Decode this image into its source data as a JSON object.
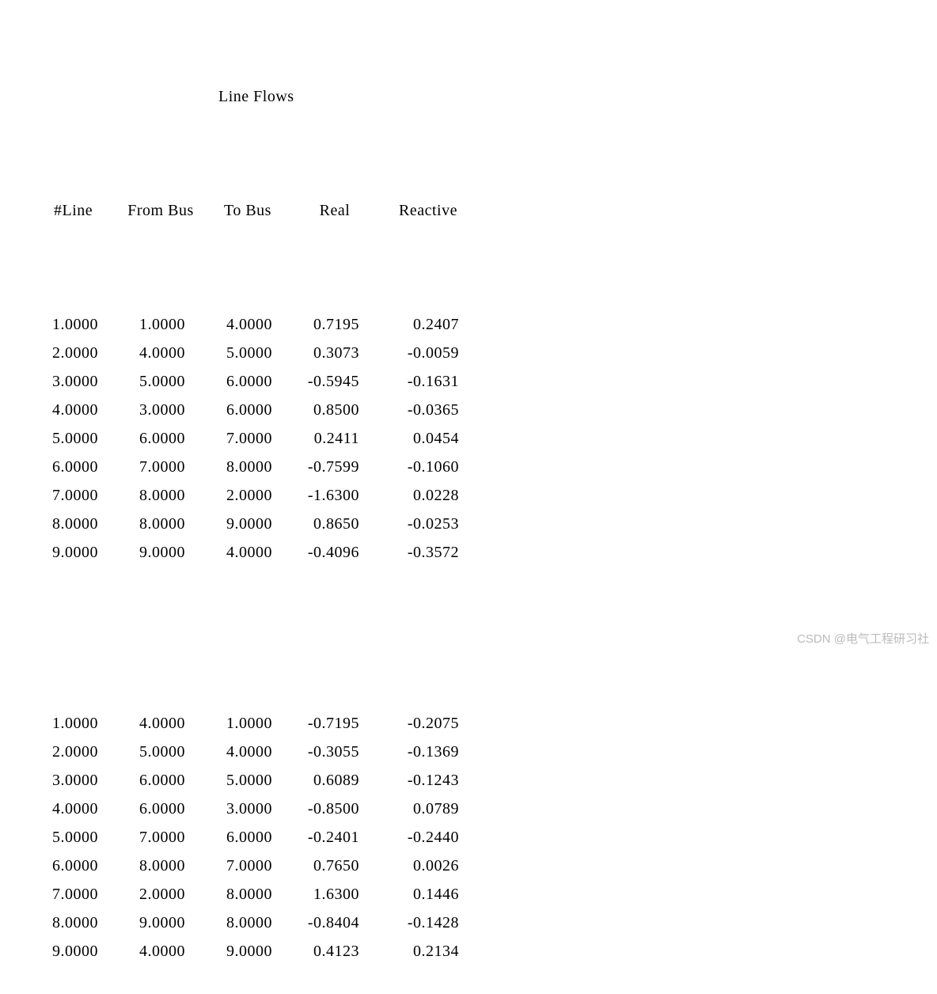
{
  "title": "Line Flows",
  "headers": {
    "line": "#Line",
    "from": "From Bus",
    "to": "To Bus",
    "real": "Real",
    "reactive": "Reactive"
  },
  "rows_a": [
    {
      "line": "1.0000",
      "from": "1.0000",
      "to": "4.0000",
      "real": "0.7195",
      "reactive": "0.2407"
    },
    {
      "line": "2.0000",
      "from": "4.0000",
      "to": "5.0000",
      "real": "0.3073",
      "reactive": "-0.0059"
    },
    {
      "line": "3.0000",
      "from": "5.0000",
      "to": "6.0000",
      "real": "-0.5945",
      "reactive": "-0.1631"
    },
    {
      "line": "4.0000",
      "from": "3.0000",
      "to": "6.0000",
      "real": "0.8500",
      "reactive": "-0.0365"
    },
    {
      "line": "5.0000",
      "from": "6.0000",
      "to": "7.0000",
      "real": "0.2411",
      "reactive": "0.0454"
    },
    {
      "line": "6.0000",
      "from": "7.0000",
      "to": "8.0000",
      "real": "-0.7599",
      "reactive": "-0.1060"
    },
    {
      "line": "7.0000",
      "from": "8.0000",
      "to": "2.0000",
      "real": "-1.6300",
      "reactive": "0.0228"
    },
    {
      "line": "8.0000",
      "from": "8.0000",
      "to": "9.0000",
      "real": "0.8650",
      "reactive": "-0.0253"
    },
    {
      "line": "9.0000",
      "from": "9.0000",
      "to": "4.0000",
      "real": "-0.4096",
      "reactive": "-0.3572"
    }
  ],
  "rows_b": [
    {
      "line": "1.0000",
      "from": "4.0000",
      "to": "1.0000",
      "real": "-0.7195",
      "reactive": "-0.2075"
    },
    {
      "line": "2.0000",
      "from": "5.0000",
      "to": "4.0000",
      "real": "-0.3055",
      "reactive": "-0.1369"
    },
    {
      "line": "3.0000",
      "from": "6.0000",
      "to": "5.0000",
      "real": "0.6089",
      "reactive": "-0.1243"
    },
    {
      "line": "4.0000",
      "from": "6.0000",
      "to": "3.0000",
      "real": "-0.8500",
      "reactive": "0.0789"
    },
    {
      "line": "5.0000",
      "from": "7.0000",
      "to": "6.0000",
      "real": "-0.2401",
      "reactive": "-0.2440"
    },
    {
      "line": "6.0000",
      "from": "8.0000",
      "to": "7.0000",
      "real": "0.7650",
      "reactive": "0.0026"
    },
    {
      "line": "7.0000",
      "from": "2.0000",
      "to": "8.0000",
      "real": "1.6300",
      "reactive": "0.1446"
    },
    {
      "line": "8.0000",
      "from": "9.0000",
      "to": "8.0000",
      "real": "-0.8404",
      "reactive": "-0.1428"
    },
    {
      "line": "9.0000",
      "from": "4.0000",
      "to": "9.0000",
      "real": "0.4123",
      "reactive": "0.2134"
    }
  ],
  "watermark": "CSDN @电气工程研习社",
  "chart_data": {
    "type": "table",
    "title": "Line Flows",
    "columns": [
      "#Line",
      "From Bus",
      "To Bus",
      "Real",
      "Reactive"
    ],
    "blocks": [
      [
        [
          1.0,
          1.0,
          4.0,
          0.7195,
          0.2407
        ],
        [
          2.0,
          4.0,
          5.0,
          0.3073,
          -0.0059
        ],
        [
          3.0,
          5.0,
          6.0,
          -0.5945,
          -0.1631
        ],
        [
          4.0,
          3.0,
          6.0,
          0.85,
          -0.0365
        ],
        [
          5.0,
          6.0,
          7.0,
          0.2411,
          0.0454
        ],
        [
          6.0,
          7.0,
          8.0,
          -0.7599,
          -0.106
        ],
        [
          7.0,
          8.0,
          2.0,
          -1.63,
          0.0228
        ],
        [
          8.0,
          8.0,
          9.0,
          0.865,
          -0.0253
        ],
        [
          9.0,
          9.0,
          4.0,
          -0.4096,
          -0.3572
        ]
      ],
      [
        [
          1.0,
          4.0,
          1.0,
          -0.7195,
          -0.2075
        ],
        [
          2.0,
          5.0,
          4.0,
          -0.3055,
          -0.1369
        ],
        [
          3.0,
          6.0,
          5.0,
          0.6089,
          -0.1243
        ],
        [
          4.0,
          6.0,
          3.0,
          -0.85,
          0.0789
        ],
        [
          5.0,
          7.0,
          6.0,
          -0.2401,
          -0.244
        ],
        [
          6.0,
          8.0,
          7.0,
          0.765,
          0.0026
        ],
        [
          7.0,
          2.0,
          8.0,
          1.63,
          0.1446
        ],
        [
          8.0,
          9.0,
          8.0,
          -0.8404,
          -0.1428
        ],
        [
          9.0,
          4.0,
          9.0,
          0.4123,
          0.2134
        ]
      ]
    ]
  }
}
